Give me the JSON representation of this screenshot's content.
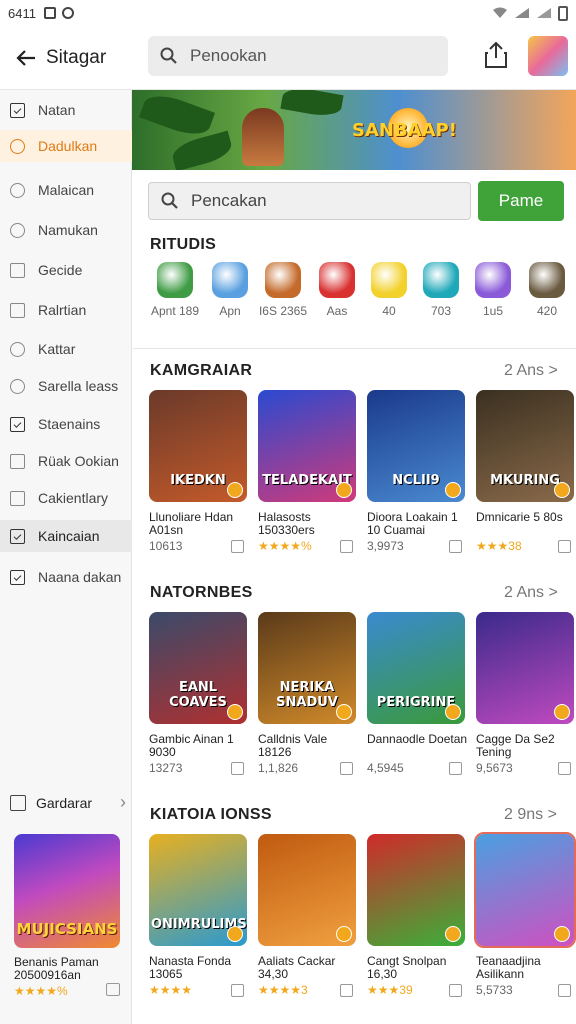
{
  "status": {
    "time": "6411"
  },
  "header": {
    "title": "Sitagar",
    "search_placeholder": "Penookan"
  },
  "sidebar": {
    "items": [
      {
        "label": "Natan"
      },
      {
        "label": "Dadulkan"
      },
      {
        "label": "Malaican"
      },
      {
        "label": "Namukan"
      },
      {
        "label": "Gecide"
      },
      {
        "label": "Ralrtian"
      },
      {
        "label": "Kattar"
      },
      {
        "label": "Sarella leass"
      },
      {
        "label": "Staenains"
      },
      {
        "label": "Rüak Ookian"
      },
      {
        "label": "Cakientlary"
      },
      {
        "label": "Kaincaian"
      },
      {
        "label": "Naana dakan"
      }
    ],
    "footer_label": "Gardarar",
    "card": {
      "thumb_label": "MUJICSIANS",
      "name": "Benanis Paman 20500916an",
      "meta": "★★★★%"
    }
  },
  "banner": {
    "text": "SANBAAP!"
  },
  "search": {
    "placeholder": "Pencakan",
    "button": "Pame"
  },
  "categories": {
    "title": "RITUDIS",
    "items": [
      {
        "label": "Apnt 189",
        "color": "#3f9c45"
      },
      {
        "label": "Apn",
        "color": "#5aa0e0"
      },
      {
        "label": "I6S 2365",
        "color": "#c46a2a"
      },
      {
        "label": "Aas",
        "color": "#d93030"
      },
      {
        "label": "40",
        "color": "#f2d12a"
      },
      {
        "label": "703",
        "color": "#1ea8b8"
      },
      {
        "label": "1u5",
        "color": "#8a5ad8"
      },
      {
        "label": "420",
        "color": "#6a5a40"
      }
    ]
  },
  "sections": [
    {
      "title": "KAMGRAIAR",
      "more": "2 Ans >",
      "cards": [
        {
          "thumb": "IKEDKN",
          "name": "Llunoliare Hdan A01sn",
          "meta": "10613",
          "stars": true,
          "colors": [
            "#6a3a2a",
            "#c45a2a"
          ]
        },
        {
          "thumb": "TELADEKAIT",
          "name": "Halasosts 150330ers",
          "meta": "★★★★%",
          "stars": true,
          "colors": [
            "#2a4ad0",
            "#d03a7a"
          ]
        },
        {
          "thumb": "NCLII9",
          "name": "Dioora Loakain 1 10 Cuamai",
          "meta": "3,9973",
          "stars": false,
          "colors": [
            "#1a3a8a",
            "#4a8ad0"
          ]
        },
        {
          "thumb": "MKURING",
          "name": "Dmnicarie 5 80s",
          "meta": "★★★38",
          "stars": false,
          "colors": [
            "#3a3020",
            "#8a6a4a"
          ]
        }
      ]
    },
    {
      "title": "NATORNBES",
      "more": "2 Ans >",
      "cards": [
        {
          "thumb": "EANL COAVES",
          "name": "Gambic Ainan 1 9030",
          "meta": "13273",
          "stars": false,
          "colors": [
            "#3a4a6a",
            "#b03030"
          ]
        },
        {
          "thumb": "NERIKA SNADUV",
          "name": "Calldnis Vale 18126",
          "meta": "1,1,826",
          "stars": false,
          "colors": [
            "#5a3a1a",
            "#d08a2a"
          ]
        },
        {
          "thumb": "PERIGRINE",
          "name": "Dannaodle Doetan",
          "meta": "4,5945",
          "stars": false,
          "colors": [
            "#3a8ad0",
            "#3a9a3a"
          ]
        },
        {
          "thumb": "",
          "name": "Cagge Da Se2 Tening",
          "meta": "9,5673",
          "stars": false,
          "colors": [
            "#3a2a8a",
            "#c04ac0"
          ]
        }
      ]
    },
    {
      "title": "KIATOIA IONSS",
      "more": "2 9ns >",
      "cards": [
        {
          "thumb": "ONIMRULIMS",
          "name": "Nanasta Fonda 13065",
          "meta": "★★★★",
          "stars": true,
          "colors": [
            "#e8b020",
            "#2a9ad0"
          ]
        },
        {
          "thumb": "",
          "name": "Aaliats Cackar 34,30",
          "meta": "★★★★3",
          "stars": false,
          "colors": [
            "#c05a10",
            "#f0a040"
          ]
        },
        {
          "thumb": "",
          "name": "Cangt Snolpan 16,30",
          "meta": "★★★39",
          "stars": false,
          "colors": [
            "#d02a2a",
            "#3ab03a"
          ]
        },
        {
          "thumb": "",
          "name": "Teanaadjina Asilikann",
          "meta": "5,5733",
          "stars": false,
          "colors": [
            "#4aa0e0",
            "#d050c0"
          ]
        }
      ]
    }
  ]
}
